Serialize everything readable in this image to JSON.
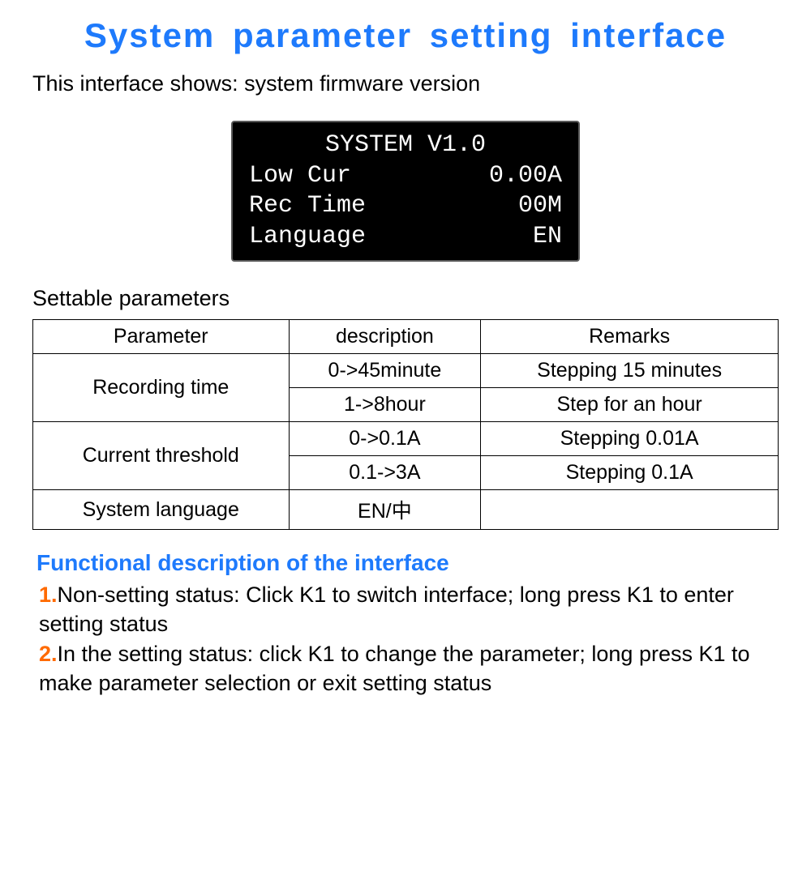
{
  "title": "System parameter setting interface",
  "intro": "This interface shows: system firmware version",
  "device_screen": {
    "header": "SYSTEM V1.0",
    "rows": [
      {
        "label": "Low Cur",
        "value": "0.00A"
      },
      {
        "label": "Rec Time",
        "value": "00M"
      },
      {
        "label": "Language",
        "value": "EN"
      }
    ]
  },
  "settable_label": "Settable parameters",
  "table": {
    "headers": {
      "c1": "Parameter",
      "c2": "description",
      "c3": "Remarks"
    },
    "rows": [
      {
        "param": "Recording time",
        "desc": "0->45minute",
        "remark": "Stepping 15 minutes"
      },
      {
        "desc": "1->8hour",
        "remark": "Step for an hour"
      },
      {
        "param": "Current threshold",
        "desc": "0->0.1A",
        "remark": "Stepping 0.01A"
      },
      {
        "desc": "0.1->3A",
        "remark": "Stepping 0.1A"
      },
      {
        "param": "System language",
        "desc": "EN/中",
        "remark": ""
      }
    ]
  },
  "functional": {
    "heading": "Functional description of the interface",
    "n1": "1.",
    "item1": "Non-setting status: Click K1 to switch interface; long press K1 to enter setting status",
    "n2": "2.",
    "item2": "In the setting status: click K1 to change the parameter; long press K1 to make parameter selection or exit setting status"
  }
}
